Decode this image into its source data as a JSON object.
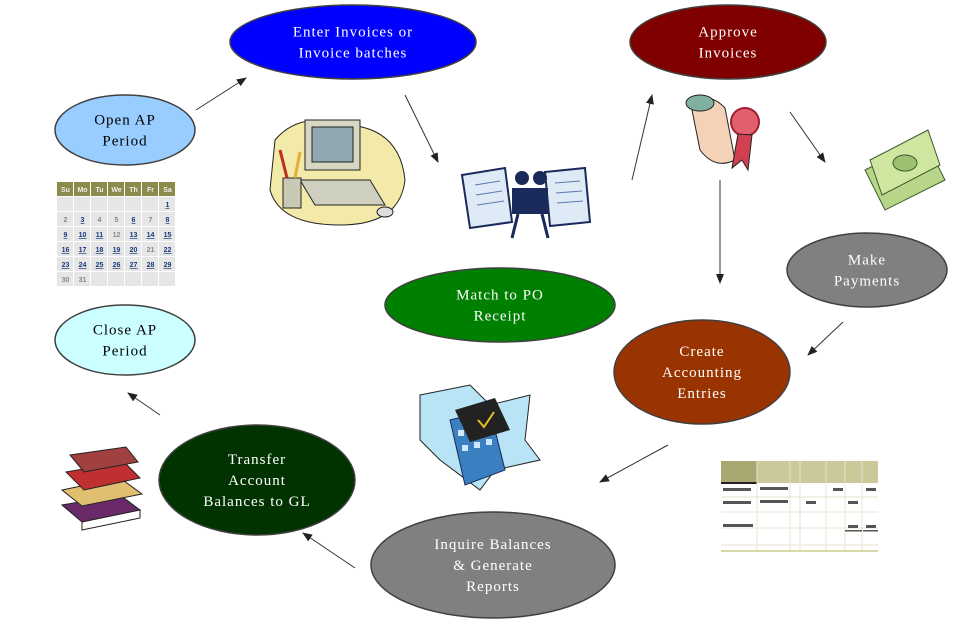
{
  "nodes": [
    {
      "id": "open",
      "lines": [
        "Open  AP",
        "Period"
      ],
      "fill": "#99ccff",
      "text": "#000000"
    },
    {
      "id": "enter",
      "lines": [
        "Enter  Invoices  or",
        "Invoice  batches"
      ],
      "fill": "#0000ff",
      "text": "#ffffff"
    },
    {
      "id": "approve",
      "lines": [
        "Approve",
        "Invoices"
      ],
      "fill": "#800000",
      "text": "#ffffff"
    },
    {
      "id": "payments",
      "lines": [
        "Make",
        "Payments"
      ],
      "fill": "#808080",
      "text": "#ffffff"
    },
    {
      "id": "match",
      "lines": [
        "Match  to  PO",
        "Receipt"
      ],
      "fill": "#008000",
      "text": "#ffffff"
    },
    {
      "id": "accounting",
      "lines": [
        "Create",
        "Accounting",
        "Entries"
      ],
      "fill": "#993300",
      "text": "#ffffff"
    },
    {
      "id": "close",
      "lines": [
        "Close  AP",
        "Period"
      ],
      "fill": "#ccffff",
      "text": "#000000"
    },
    {
      "id": "transfer",
      "lines": [
        "Transfer",
        "Account",
        "Balances  to  GL"
      ],
      "fill": "#003300",
      "text": "#ffffff"
    },
    {
      "id": "inquire",
      "lines": [
        "Inquire  Balances",
        "&  Generate",
        "Reports"
      ],
      "fill": "#808080",
      "text": "#ffffff"
    }
  ],
  "calendar": {
    "days": [
      "Su",
      "Mo",
      "Tu",
      "We",
      "Th",
      "Fr",
      "Sa"
    ],
    "weeks": [
      [
        "",
        "",
        "",
        "",
        "",
        "",
        "1"
      ],
      [
        "2",
        "3",
        "4",
        "5",
        "6",
        "7",
        "8"
      ],
      [
        "9",
        "10",
        "11",
        "12",
        "13",
        "14",
        "15"
      ],
      [
        "16",
        "17",
        "18",
        "19",
        "20",
        "21",
        "22"
      ],
      [
        "23",
        "24",
        "25",
        "26",
        "27",
        "28",
        "29"
      ],
      [
        "30",
        "31",
        "",
        "",
        "",
        "",
        ""
      ]
    ],
    "header_color": "#8b8b4b"
  }
}
